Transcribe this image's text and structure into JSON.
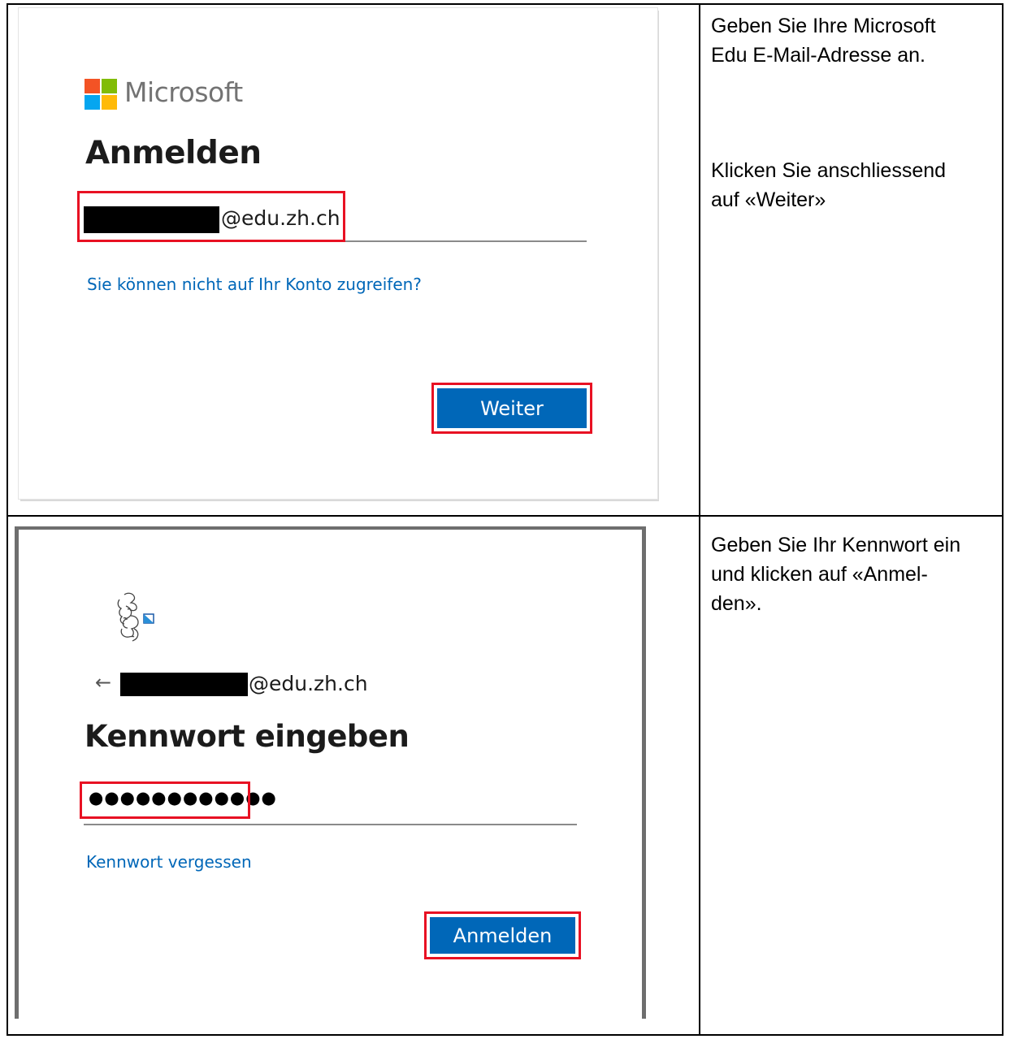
{
  "step1": {
    "brand": "Microsoft",
    "heading": "Anmelden",
    "email_suffix": "@edu.zh.ch",
    "help_link": "Sie können nicht auf Ihr Konto zugreifen?",
    "next_button": "Weiter",
    "instruction_1": "Geben Sie Ihre Microsoft\nEdu E-Mail-Adresse an.",
    "instruction_2": "Klicken Sie anschliessend\nauf «Weiter»"
  },
  "step2": {
    "back_icon": "←",
    "email_suffix": "@edu.zh.ch",
    "heading": "Kennwort eingeben",
    "password_mask": "●●●●●●●●●●●●",
    "forgot_link": "Kennwort vergessen",
    "signin_button": "Anmelden",
    "instruction": "Geben Sie Ihr Kennwort ein\nund klicken auf «Anmel-\nden»."
  },
  "colors": {
    "accent_blue": "#0067b8",
    "highlight_red": "#e81123",
    "ms_red": "#f35325",
    "ms_green": "#81bc06",
    "ms_blue": "#05a6f0",
    "ms_yellow": "#ffba08"
  },
  "icons": [
    "microsoft-logo-icon",
    "zurich-lion-logo-icon",
    "back-arrow-icon"
  ]
}
